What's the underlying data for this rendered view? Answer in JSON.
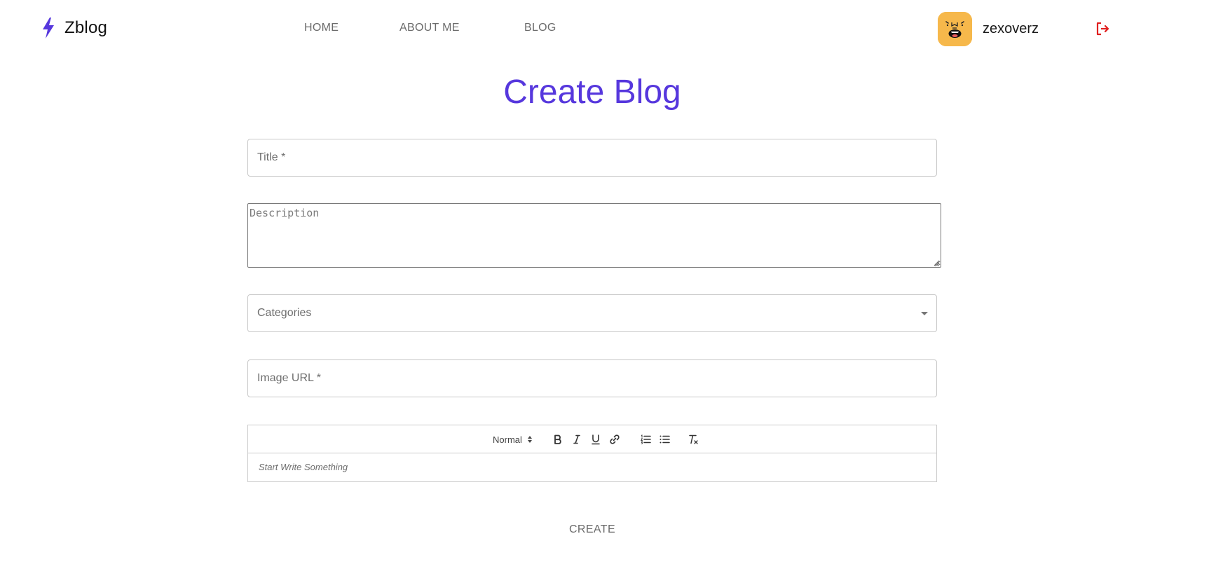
{
  "header": {
    "brand": "Zblog",
    "nav": {
      "home": "HOME",
      "about": "ABOUT ME",
      "blog": "BLOG"
    },
    "username": "zexoverz"
  },
  "page": {
    "title": "Create Blog"
  },
  "form": {
    "title_placeholder": "Title *",
    "description_placeholder": "Description",
    "categories_label": "Categories",
    "image_url_placeholder": "Image URL *",
    "editor": {
      "header_select": "Normal",
      "placeholder": "Start Write Something"
    },
    "submit_label": "CREATE"
  },
  "colors": {
    "accent": "#5637dd",
    "logout": "#e02020",
    "avatar_bg": "#f6b84b"
  },
  "icons": {
    "brand": "lightning-bolt-icon",
    "logout": "logout-icon",
    "dropdown": "caret-down-icon"
  }
}
